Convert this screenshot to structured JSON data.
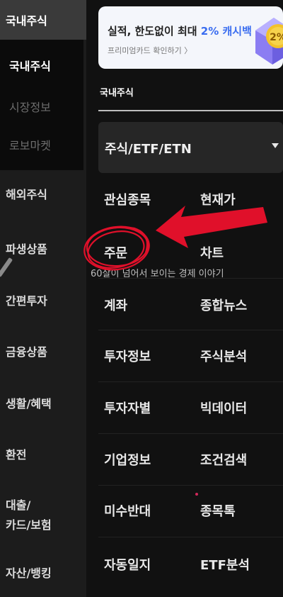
{
  "sidebar": {
    "active_category": "국내주식",
    "sub_items": [
      {
        "label": "국내주식",
        "active": true
      },
      {
        "label": "시장정보",
        "active": false
      },
      {
        "label": "로보마켓",
        "active": false
      }
    ],
    "categories": [
      {
        "label": "해외주식"
      },
      {
        "label": "파생상품"
      },
      {
        "label": "간편투자"
      },
      {
        "label": "금융상품"
      },
      {
        "label": "생활/혜택"
      },
      {
        "label": "환전"
      },
      {
        "label": "대출/"
      },
      {
        "label": "카드/보험"
      },
      {
        "label": "자산/뱅킹"
      }
    ]
  },
  "banner": {
    "title_prefix": "실적, 한도없이 최대",
    "title_highlight": "2% 캐시백",
    "subtitle": "프리미엄카드 확인하기 〉",
    "badge": "2%"
  },
  "section": {
    "label": "국내주식"
  },
  "dropdown": {
    "value": "주식/ETF/ETN"
  },
  "menu": [
    [
      "관심종목",
      "현재가"
    ],
    [
      "주문",
      "차트"
    ],
    [
      "계좌",
      "종합뉴스"
    ],
    [
      "투자정보",
      "주식분석"
    ],
    [
      "투자자별",
      "빅데이터"
    ],
    [
      "기업정보",
      "조건검색"
    ],
    [
      "미수반대",
      "종목톡"
    ],
    [
      "자동일지",
      "ETF분석"
    ]
  ],
  "watermark": "60살이 넘어서 보이는 경제 이야기",
  "colors": {
    "annotation_red": "#e0102a",
    "banner_accent": "#3a6df0",
    "background": "#111111"
  }
}
